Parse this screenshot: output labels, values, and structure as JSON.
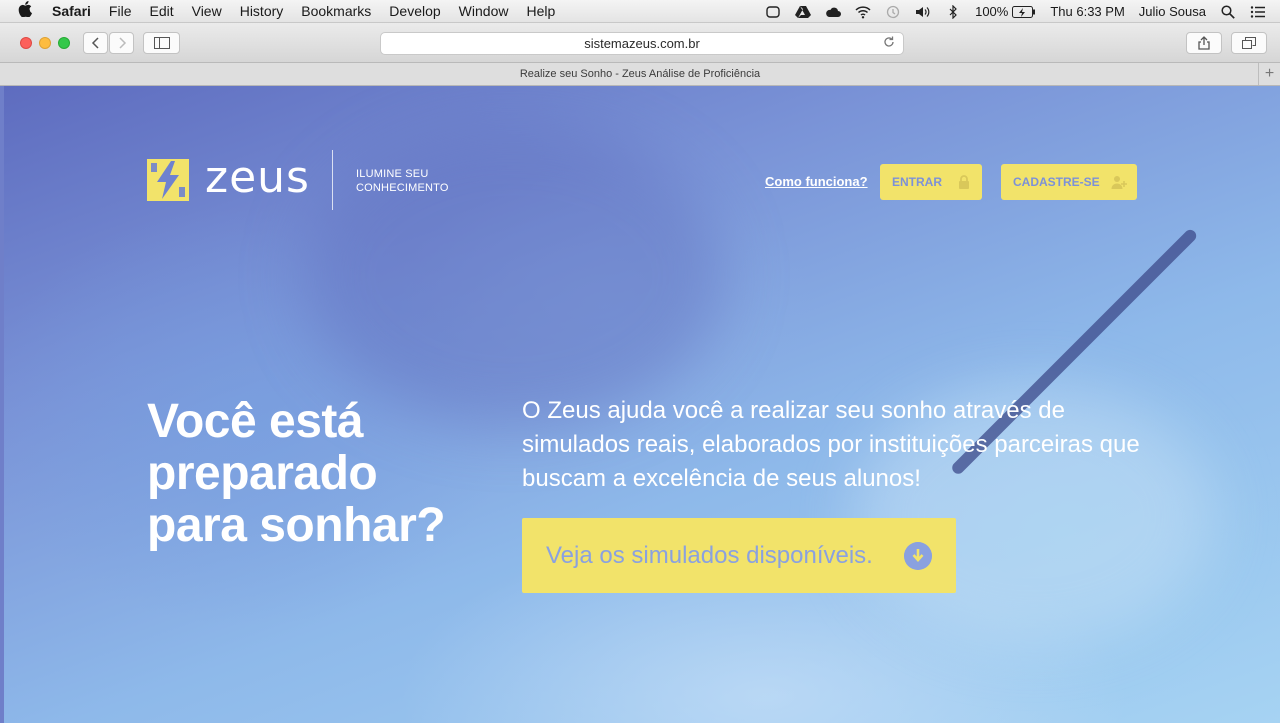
{
  "menubar": {
    "app": "Safari",
    "items": [
      "File",
      "Edit",
      "View",
      "History",
      "Bookmarks",
      "Develop",
      "Window",
      "Help"
    ],
    "battery": "100%",
    "clock": "Thu 6:33 PM",
    "user": "Julio Sousa"
  },
  "browser": {
    "url": "sistemazeus.com.br",
    "tab_title": "Realize seu Sonho - Zeus Análise de Proficiência"
  },
  "site": {
    "brand": "zeus",
    "tagline_line1": "ILUMINE SEU",
    "tagline_line2": "CONHECIMENTO",
    "nav_link": "Como funciona?",
    "btn_entrar": "ENTRAR",
    "btn_cadastre": "CADASTRE-SE",
    "headline_line1": "Você está",
    "headline_line2": "preparado",
    "headline_line3": "para sonhar?",
    "intro": "O Zeus ajuda você a realizar seu sonho através de simulados reais, elaborados por instituições parceiras que buscam a excelência de seus alunos!",
    "cta": "Veja os simulados disponíveis."
  },
  "colors": {
    "accent_yellow": "#f2e36a",
    "hero_blue": "#7a93d7",
    "button_text": "#7c91d8"
  },
  "icons": [
    "apple-icon",
    "dropbox-icon",
    "drive-icon",
    "cloud-icon",
    "wifi-icon",
    "time-machine-icon",
    "volume-icon",
    "bluetooth-icon",
    "battery-icon",
    "spotlight-icon",
    "notification-icon",
    "back-icon",
    "forward-icon",
    "sidebar-icon",
    "reload-icon",
    "share-icon",
    "tabs-icon",
    "new-tab-icon",
    "zeus-logo-icon",
    "lock-icon",
    "add-user-icon",
    "arrow-down-icon"
  ]
}
